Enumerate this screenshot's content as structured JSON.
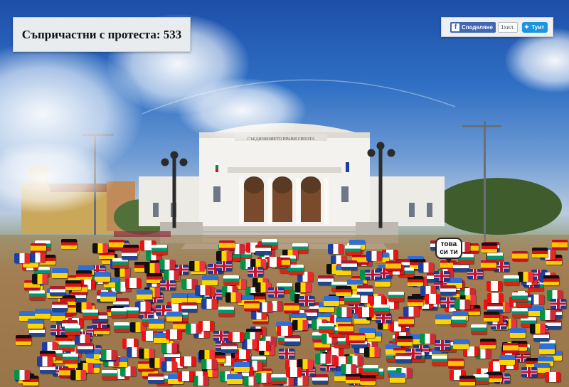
{
  "counter": {
    "label": "Съпричастни с протеста: 533"
  },
  "share": {
    "facebook_label": "Споделяне",
    "facebook_count": "1хил.",
    "twitter_label": "Туит",
    "facebook_icon": "facebook-f-icon",
    "twitter_icon": "twitter-bird-icon"
  },
  "building": {
    "inscription": "СЪЕДИНЕНИЕТО ПРАВИ СИЛАТА"
  },
  "speech_bubble": {
    "line1": "това",
    "line2": "си ти"
  },
  "colors": {
    "sky_top": "#1d4fa8",
    "ground": "#a37e52",
    "facebook": "#4267b2",
    "twitter": "#1b95e0"
  },
  "flag_types": [
    "bg",
    "ua",
    "uk",
    "fr",
    "de",
    "be",
    "nl",
    "ca",
    "es",
    "it"
  ]
}
